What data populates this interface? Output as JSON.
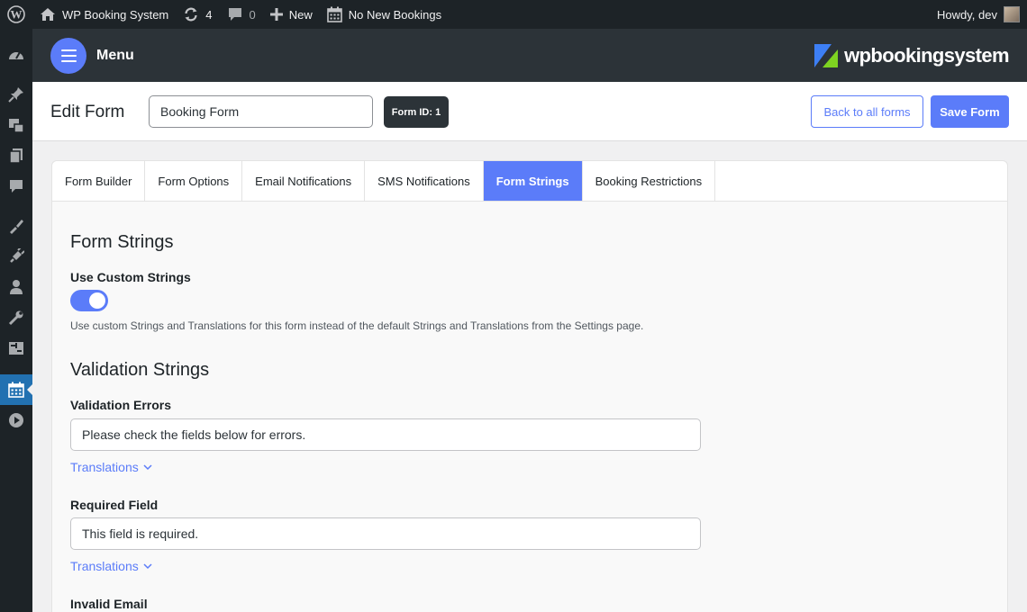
{
  "adminbar": {
    "site_name": "WP Booking System",
    "updates_count": "4",
    "comments_count": "0",
    "new_label": "New",
    "bookings_label": "No New Bookings",
    "howdy": "Howdy, dev"
  },
  "sidemenu": {
    "items": [
      "dashboard-icon",
      "pin-icon",
      "media-icon",
      "pages-icon",
      "comments-icon",
      "appearance-icon",
      "plugins-icon",
      "users-icon",
      "tools-icon",
      "settings-icon",
      "calendar-icon",
      "play-icon"
    ],
    "active": "calendar-icon"
  },
  "header": {
    "menu_label": "Menu",
    "brand": "wpbookingsystem"
  },
  "editbar": {
    "title": "Edit Form",
    "form_name": "Booking Form",
    "form_id": "Form ID: 1",
    "back_label": "Back to all forms",
    "save_label": "Save Form"
  },
  "tabs": [
    "Form Builder",
    "Form Options",
    "Email Notifications",
    "SMS Notifications",
    "Form Strings",
    "Booking Restrictions"
  ],
  "active_tab": "Form Strings",
  "form_strings": {
    "heading": "Form Strings",
    "custom_label": "Use Custom Strings",
    "custom_enabled": true,
    "custom_help": "Use custom Strings and Translations for this form instead of the default Strings and Translations from the Settings page."
  },
  "validation": {
    "heading": "Validation Strings",
    "translations_label": "Translations",
    "fields": [
      {
        "label": "Validation Errors",
        "value": "Please check the fields below for errors."
      },
      {
        "label": "Required Field",
        "value": "This field is required."
      },
      {
        "label": "Invalid Email",
        "value": ""
      }
    ]
  },
  "colors": {
    "accent": "#5b7cf9",
    "admin_dark": "#1d2327",
    "header_dark": "#2c3338",
    "wp_active": "#2271b1",
    "logo_blue": "#3d7ff5",
    "logo_green": "#7ed321"
  }
}
